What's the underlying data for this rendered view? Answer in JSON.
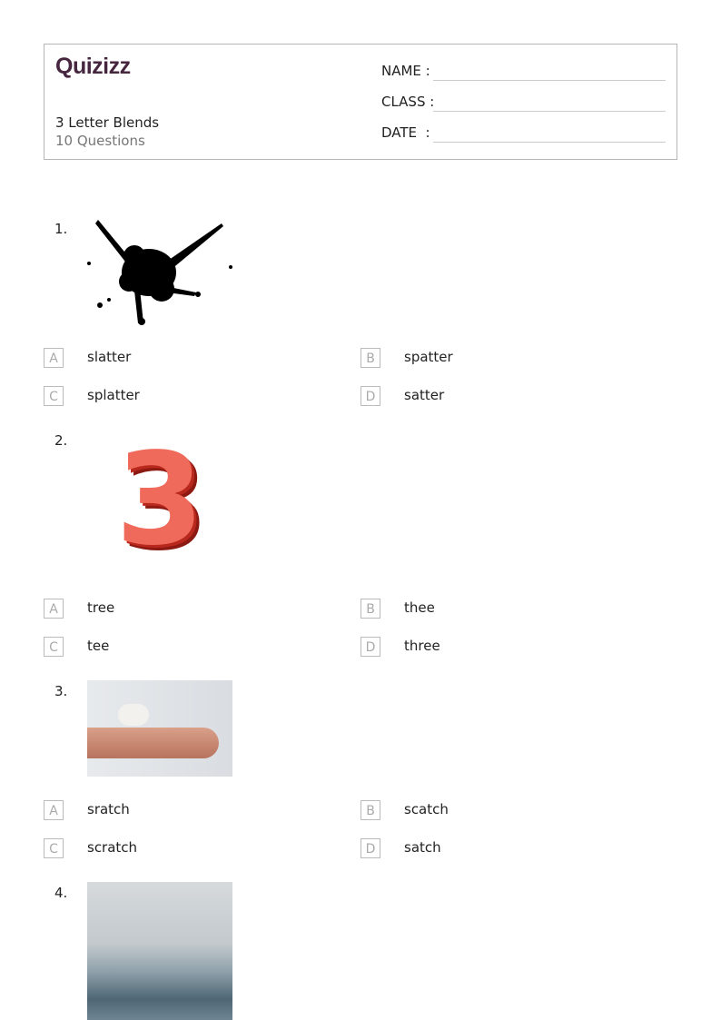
{
  "header": {
    "logo": "Quizizz",
    "title": "3 Letter Blends",
    "subtitle": "10 Questions",
    "fields": [
      {
        "label": "NAME :"
      },
      {
        "label": "CLASS :"
      },
      {
        "label": "DATE  :"
      }
    ]
  },
  "questions": [
    {
      "number": "1.",
      "image": "ink-splatter",
      "options": [
        {
          "letter": "A",
          "text": "slatter"
        },
        {
          "letter": "B",
          "text": "spatter"
        },
        {
          "letter": "C",
          "text": "splatter"
        },
        {
          "letter": "D",
          "text": "satter"
        }
      ]
    },
    {
      "number": "2.",
      "image": "red-number-three",
      "image_text": "3",
      "options": [
        {
          "letter": "A",
          "text": "tree"
        },
        {
          "letter": "B",
          "text": "thee"
        },
        {
          "letter": "C",
          "text": "tee"
        },
        {
          "letter": "D",
          "text": "three"
        }
      ]
    },
    {
      "number": "3.",
      "image": "cat-paw-scratching-hand",
      "options": [
        {
          "letter": "A",
          "text": "sratch"
        },
        {
          "letter": "B",
          "text": "scatch"
        },
        {
          "letter": "C",
          "text": "scratch"
        },
        {
          "letter": "D",
          "text": "satch"
        }
      ]
    },
    {
      "number": "4.",
      "image": "water-splash"
    }
  ],
  "colors": {
    "brand": "#46263f",
    "border": "#b5b5b5",
    "muted": "#777777"
  }
}
